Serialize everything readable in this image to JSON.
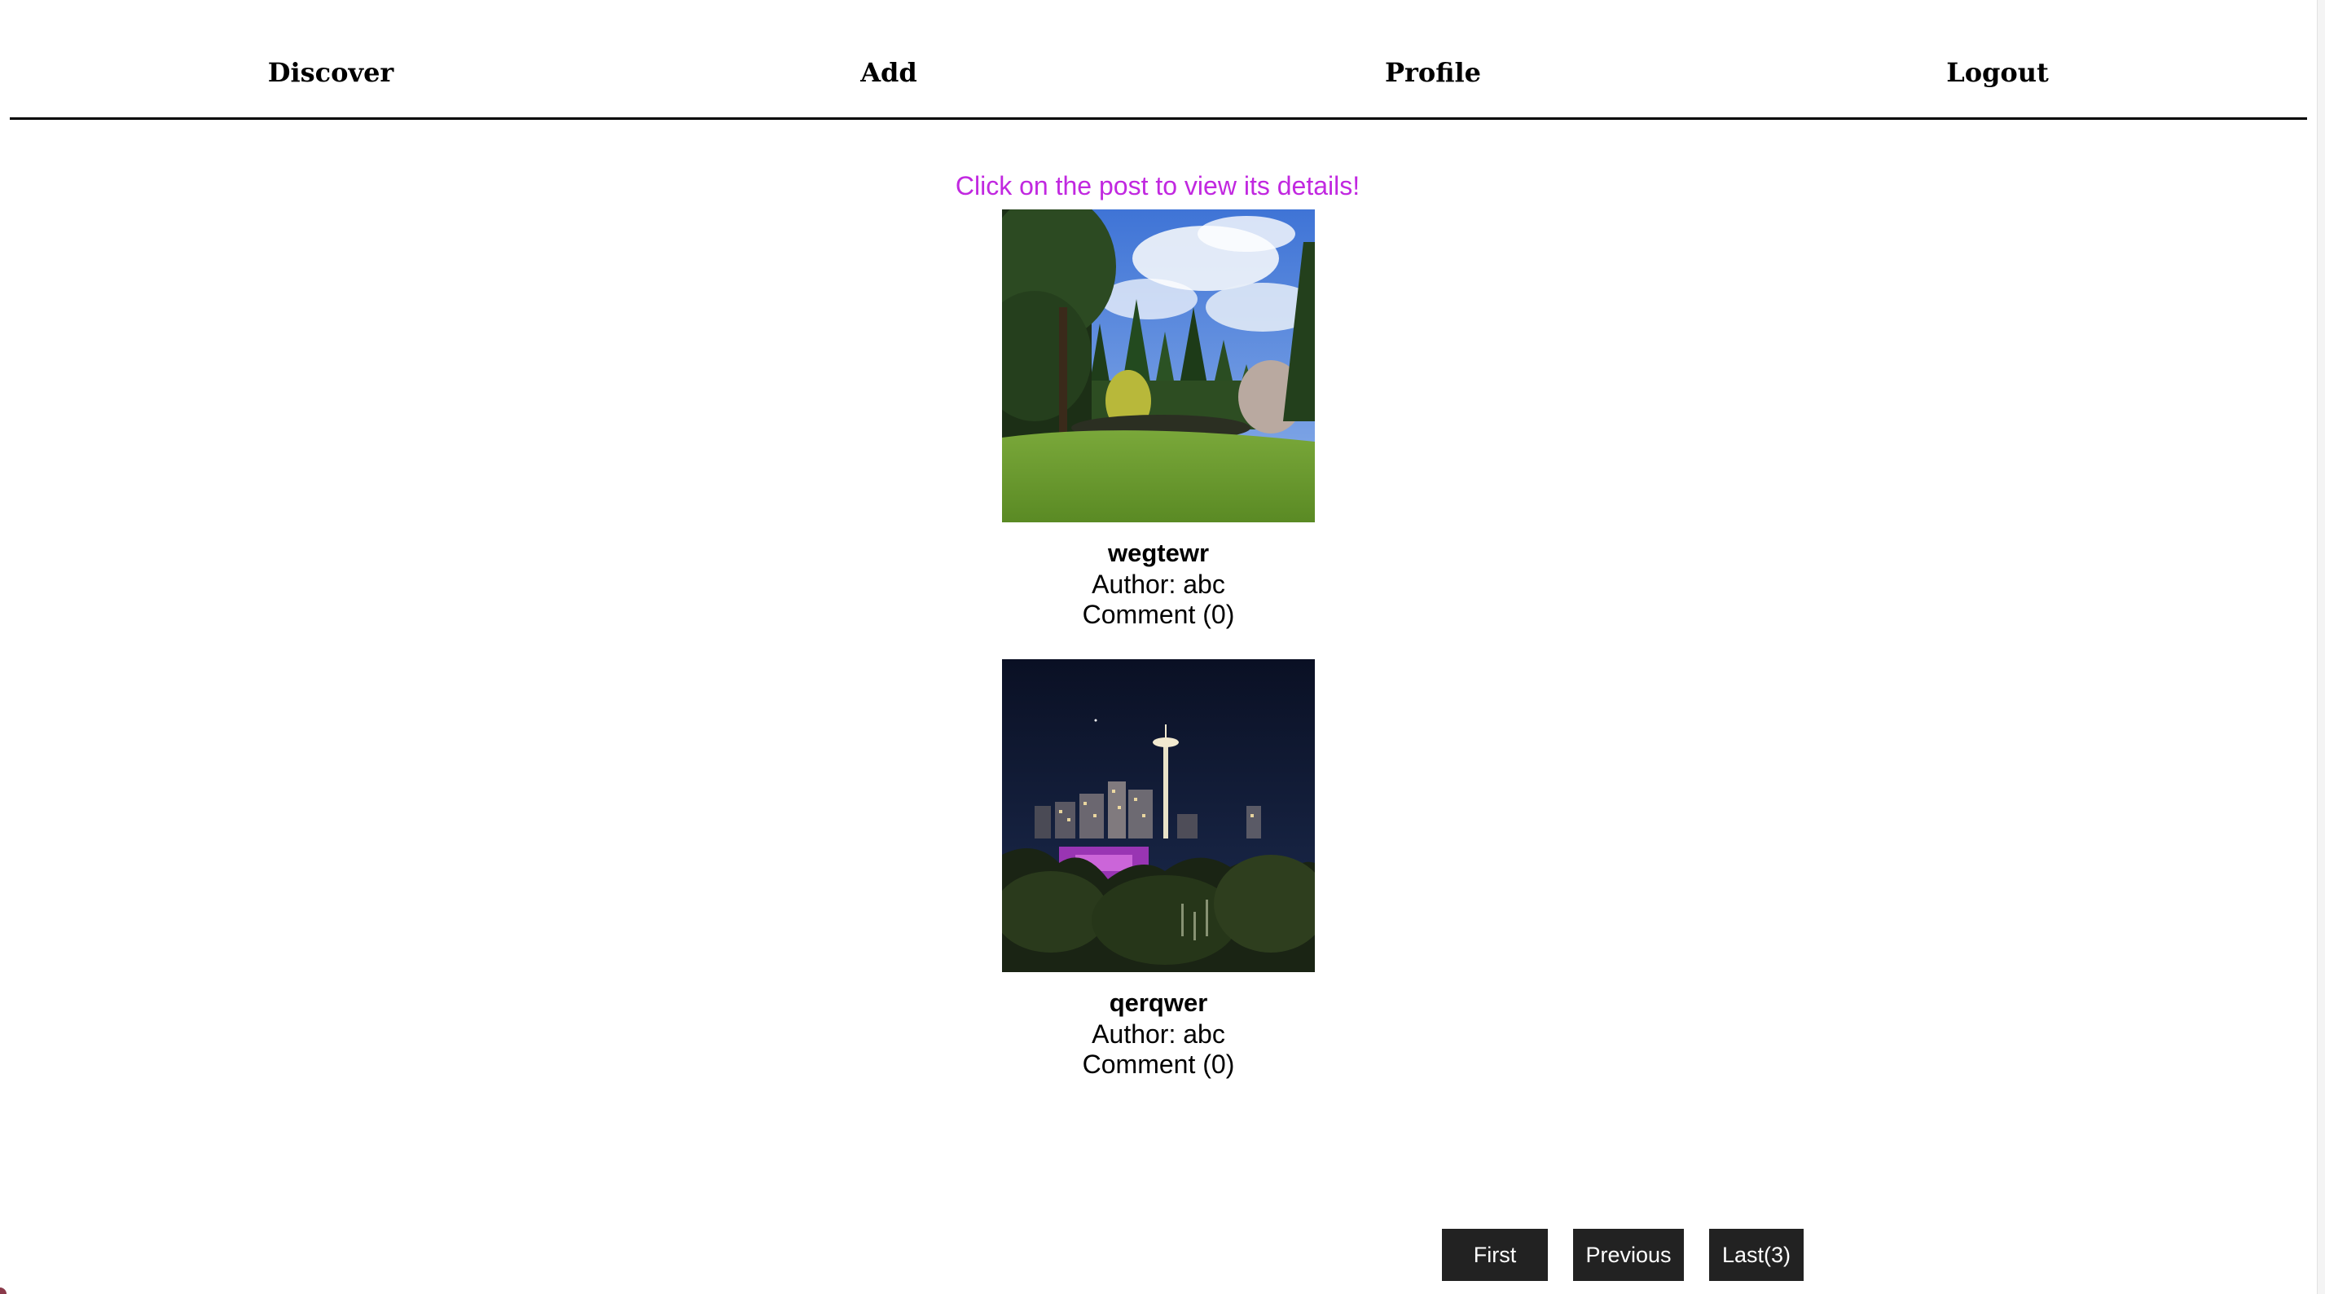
{
  "nav": {
    "items": [
      {
        "label": "Discover"
      },
      {
        "label": "Add"
      },
      {
        "label": "Profile"
      },
      {
        "label": "Logout"
      }
    ]
  },
  "hint": "Click on the post to view its details!",
  "posts": [
    {
      "title": "wegtewr",
      "author": "Author: abc",
      "comments": "Comment (0)",
      "image": "park-landscape-photo"
    },
    {
      "title": "qerqwer",
      "author": "Author: abc",
      "comments": "Comment (0)",
      "image": "city-skyline-night-photo"
    }
  ],
  "pagination": {
    "first": "First",
    "previous": "Previous",
    "last": "Last(3)"
  },
  "colors": {
    "hint": "#c128e0",
    "button_bg": "#222222",
    "button_text": "#ffffff"
  }
}
